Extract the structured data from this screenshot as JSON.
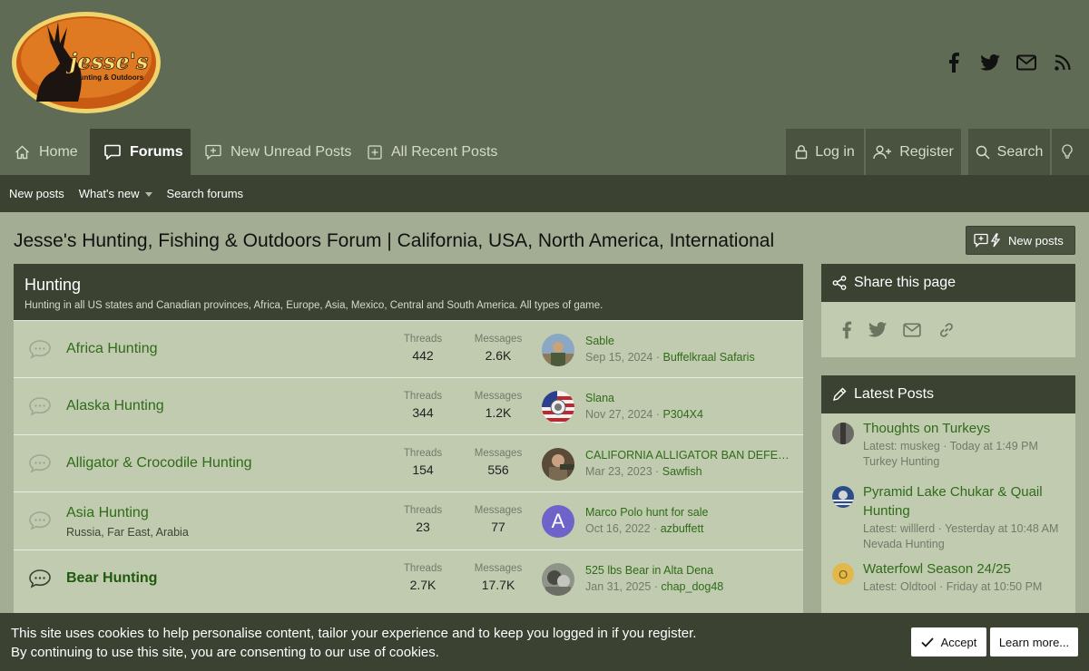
{
  "logo": {
    "text": "jesse's",
    "subtext": "Hunting & Outdoors"
  },
  "social": [
    "facebook-icon",
    "twitter-icon",
    "mail-icon",
    "rss-icon"
  ],
  "nav": {
    "home": "Home",
    "forums": "Forums",
    "new_unread": "New Unread Posts",
    "all_recent": "All Recent Posts",
    "login": "Log in",
    "register": "Register",
    "search": "Search"
  },
  "subnav": {
    "new_posts": "New posts",
    "whats_new": "What's new",
    "search_forums": "Search forums"
  },
  "page_title": "Jesse's Hunting, Fishing & Outdoors Forum | California, USA, North America, International",
  "new_posts_button": "New posts",
  "block": {
    "title": "Hunting",
    "description": "Hunting in all US states and Canadian provinces, Africa, Europe, Asia, Mexico, Central and South America. All types of game.",
    "threads_label": "Threads",
    "messages_label": "Messages",
    "forums": [
      {
        "name": "Africa Hunting",
        "desc": "",
        "threads": "442",
        "messages": "2.6K",
        "last_title": "Sable",
        "last_date": "Sep 15, 2024",
        "last_user": "Buffelkraal Safaris"
      },
      {
        "name": "Alaska Hunting",
        "desc": "",
        "threads": "344",
        "messages": "1.2K",
        "last_title": "Slana",
        "last_date": "Nov 27, 2024",
        "last_user": "P304X4"
      },
      {
        "name": "Alligator & Crocodile Hunting",
        "desc": "",
        "threads": "154",
        "messages": "556",
        "last_title": "CALIFORNIA ALLIGATOR BAN DEFEATED",
        "last_date": "Mar 23, 2023",
        "last_user": "Sawfish"
      },
      {
        "name": "Asia Hunting",
        "desc": "Russia, Far East, Arabia",
        "threads": "23",
        "messages": "77",
        "last_title": "Marco Polo hunt for sale",
        "last_date": "Oct 16, 2022",
        "last_user": "azbuffett",
        "avatar_letter": "A"
      },
      {
        "name": "Bear Hunting",
        "desc": "",
        "threads": "2.7K",
        "messages": "17.7K",
        "last_title": "525 lbs Bear in Alta Dena",
        "last_date": "Jan 31, 2025",
        "last_user": "chap_dog48"
      }
    ]
  },
  "share": {
    "title": "Share this page"
  },
  "latest": {
    "title": "Latest Posts",
    "posts": [
      {
        "title": "Thoughts on Turkeys",
        "meta": "Latest: muskeg · Today at 1:49 PM",
        "forum": "Turkey Hunting"
      },
      {
        "title": "Pyramid Lake Chukar & Quail Hunting",
        "meta": "Latest: willlerd · Yesterday at 10:48 AM",
        "forum": "Nevada Hunting"
      },
      {
        "title": "Waterfowl Season 24/25",
        "meta": "Latest: Oldtool · Friday at 10:50 PM",
        "forum": "",
        "avatar_letter": "O"
      }
    ]
  },
  "cookie": {
    "line1": "This site uses cookies to help personalise content, tailor your experience and to keep you logged in if you register.",
    "line2": "By continuing to use this site, you are consenting to our use of cookies.",
    "accept": "Accept",
    "learn_more": "Learn more..."
  },
  "colors": {
    "header": "#5f6b54",
    "dark": "#3b4232",
    "link": "#2f6b18",
    "row": "#c0cbb0",
    "page": "#a3ad93"
  }
}
